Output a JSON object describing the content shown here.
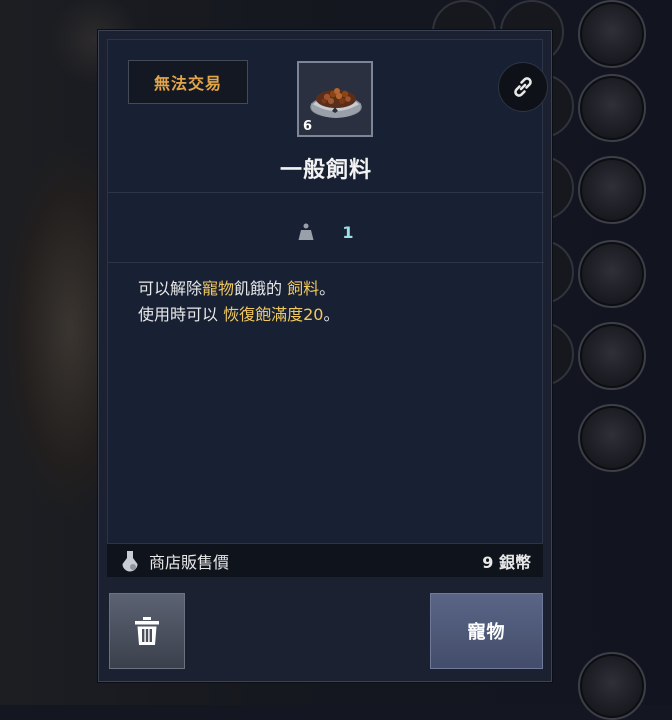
{
  "item": {
    "trade_badge": "無法交易",
    "name": "一般飼料",
    "quantity": "6",
    "icon": "pet-food-bowl-icon"
  },
  "stat": {
    "icon": "weight-icon",
    "value": "1"
  },
  "description": {
    "line1_a": "可以解除",
    "line1_b": "寵物",
    "line1_c": "飢餓的 ",
    "line1_d": "飼料",
    "line1_e": "。",
    "line2_a": "使用時可以 ",
    "line2_b": "恢復飽滿度20",
    "line2_c": "。"
  },
  "price": {
    "icon": "potion-bag-icon",
    "label": "商店販售價",
    "value": "9 銀幣"
  },
  "actions": {
    "delete_icon": "trash-icon",
    "pet_label": "寵物"
  },
  "colors": {
    "highlight": "#f0c860",
    "badge_text": "#e2a54a",
    "stat_value": "#9fe0e8"
  }
}
